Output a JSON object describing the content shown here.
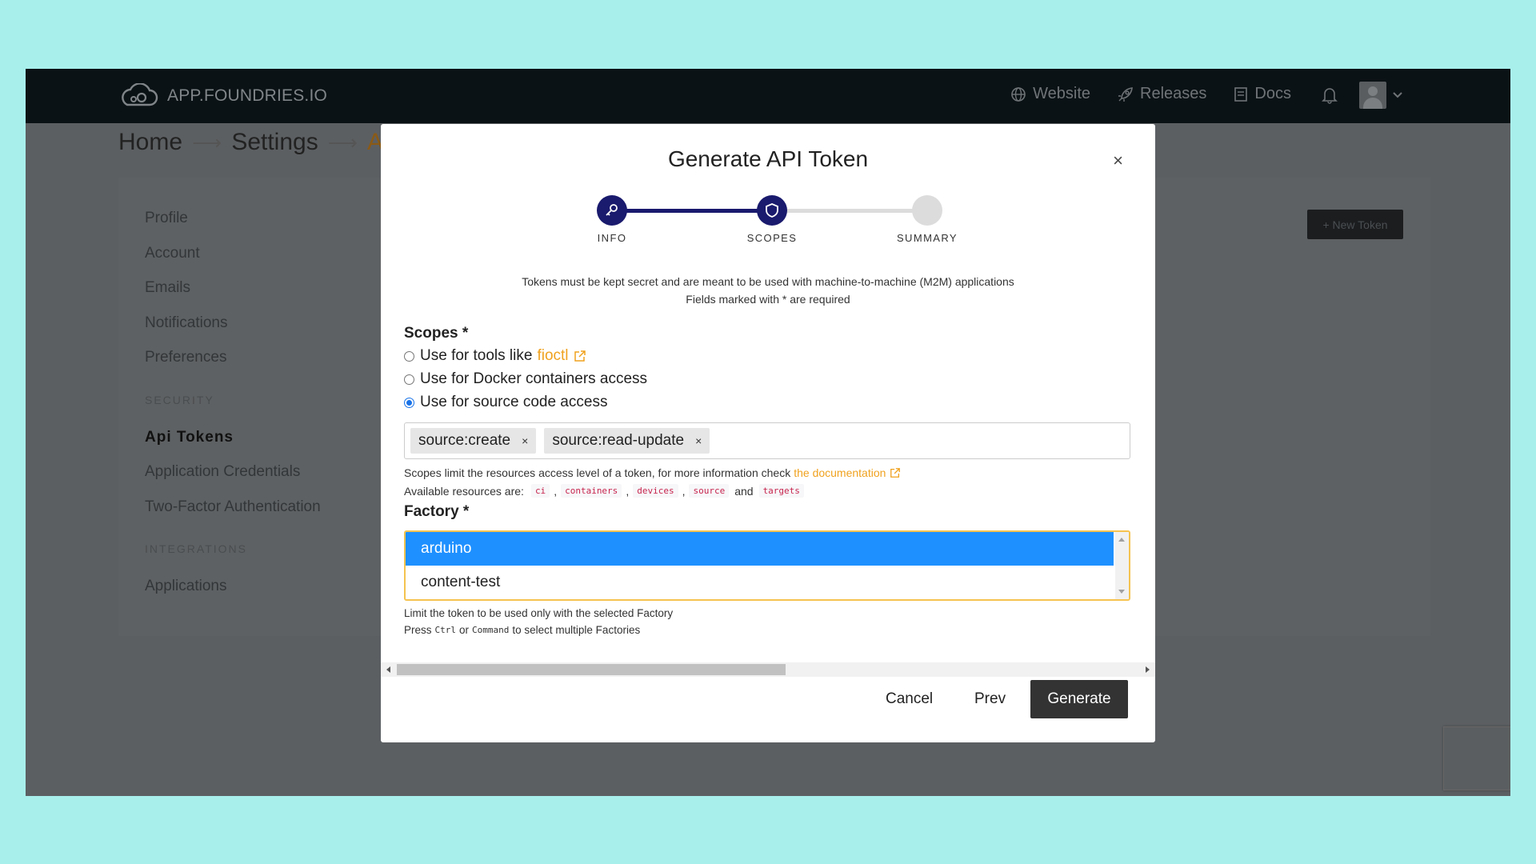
{
  "navbar": {
    "brand": "APP.FOUNDRIES.IO",
    "links": [
      {
        "label": "Website",
        "icon": "globe-icon"
      },
      {
        "label": "Releases",
        "icon": "rocket-icon"
      },
      {
        "label": "Docs",
        "icon": "book-icon"
      }
    ]
  },
  "breadcrumb": {
    "home": "Home",
    "settings": "Settings",
    "current": "Api",
    "separator": "⟶"
  },
  "sidebar": {
    "items": [
      "Profile",
      "Account",
      "Emails",
      "Notifications",
      "Preferences"
    ],
    "security_heading": "SECURITY",
    "security_items": [
      "Api Tokens",
      "Application Credentials",
      "Two-Factor Authentication"
    ],
    "integrations_heading": "INTEGRATIONS",
    "integrations_items": [
      "Applications"
    ]
  },
  "new_token_button": "+ New Token",
  "modal": {
    "title": "Generate API Token",
    "close": "×",
    "steps": [
      {
        "label": "INFO",
        "state": "complete"
      },
      {
        "label": "SCOPES",
        "state": "active"
      },
      {
        "label": "SUMMARY",
        "state": "pending"
      }
    ],
    "notice_line1": "Tokens must be kept secret and are meant to be used with machine-to-machine (M2M) applications",
    "notice_line2": "Fields marked with * are required",
    "scopes_label": "Scopes *",
    "scope_options": [
      {
        "label": "Use for tools like",
        "link": "fioctl",
        "checked": false
      },
      {
        "label": "Use for Docker containers access",
        "checked": false
      },
      {
        "label": "Use for source code access",
        "checked": true
      }
    ],
    "selected_scopes": [
      "source:create",
      "source:read-update"
    ],
    "scopes_help": "Scopes limit the resources access level of a token, for more information check",
    "scopes_help_link": "the documentation",
    "resources_prefix": "Available resources are:",
    "resources": [
      "ci",
      "containers",
      "devices",
      "source",
      "targets"
    ],
    "resources_and": "and",
    "factory_label": "Factory *",
    "factories": [
      {
        "name": "arduino",
        "selected": true
      },
      {
        "name": "content-test",
        "selected": false
      }
    ],
    "factory_help1": "Limit the token to be used only with the selected Factory",
    "factory_help2_pre": "Press",
    "factory_help2_key1": "Ctrl",
    "factory_help2_or": "or",
    "factory_help2_key2": "Command",
    "factory_help2_post": "to select multiple Factories",
    "buttons": {
      "cancel": "Cancel",
      "prev": "Prev",
      "generate": "Generate"
    }
  },
  "colors": {
    "background": "#a8efec",
    "stepper_active": "#1a1a6e",
    "accent_orange": "#f0a21f",
    "selected_option": "#1e90ff"
  }
}
